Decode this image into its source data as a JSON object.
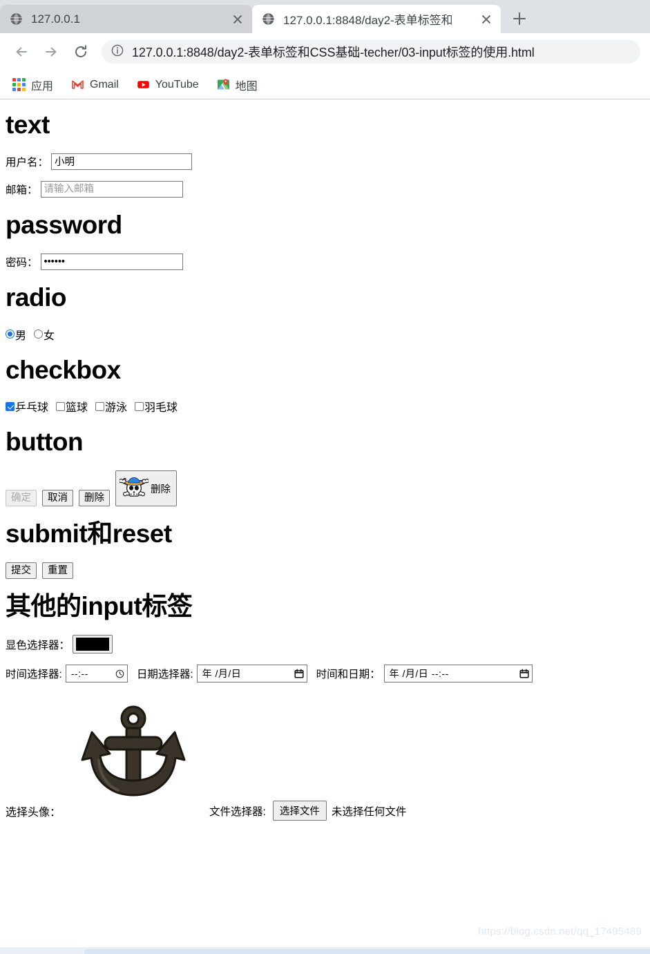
{
  "browser": {
    "tabs": [
      {
        "title": "127.0.0.1",
        "favicon": "globe-icon",
        "active": false
      },
      {
        "title": "127.0.0.1:8848/day2-表单标签和",
        "favicon": "globe-icon",
        "active": true
      }
    ],
    "new_tab_label": "+",
    "nav": {
      "back_icon": "back-arrow-icon",
      "forward_icon": "forward-arrow-icon",
      "reload_icon": "reload-icon"
    },
    "omnibox": {
      "info_icon": "info-circle-icon",
      "url": "127.0.0.1:8848/day2-表单标签和CSS基础-techer/03-input标签的使用.html"
    },
    "bookmarks": [
      {
        "label": "应用",
        "icon": "apps-grid-icon"
      },
      {
        "label": "Gmail",
        "icon": "gmail-icon"
      },
      {
        "label": "YouTube",
        "icon": "youtube-icon"
      },
      {
        "label": "地图",
        "icon": "maps-pin-icon"
      }
    ]
  },
  "page": {
    "sections": {
      "text": {
        "heading": "text",
        "username_label": "用户名：",
        "username_value": "小明",
        "email_label": "邮箱：",
        "email_placeholder": "请输入邮箱",
        "email_value": ""
      },
      "password": {
        "heading": "password",
        "label": "密码：",
        "value": "••••••"
      },
      "radio": {
        "heading": "radio",
        "options": [
          {
            "label": "男",
            "checked": true
          },
          {
            "label": "女",
            "checked": false
          }
        ]
      },
      "checkbox": {
        "heading": "checkbox",
        "options": [
          {
            "label": "乒乓球",
            "checked": true
          },
          {
            "label": "篮球",
            "checked": false
          },
          {
            "label": "游泳",
            "checked": false
          },
          {
            "label": "羽毛球",
            "checked": false
          }
        ]
      },
      "button": {
        "heading": "button",
        "buttons": [
          {
            "label": "确定",
            "disabled": true
          },
          {
            "label": "取消",
            "disabled": false
          },
          {
            "label": "删除",
            "disabled": false
          }
        ],
        "image_button": {
          "label": "删除",
          "icon": "pirate-skull-icon"
        }
      },
      "submit_reset": {
        "heading": "submit和reset",
        "submit_label": "提交",
        "reset_label": "重置"
      },
      "other": {
        "heading": "其他的input标签",
        "color_label": "显色选择器：",
        "color_value": "#000000",
        "time_label": "时间选择器:",
        "time_value": "--:--",
        "time_icon": "clock-icon",
        "date_label": "日期选择器:",
        "date_value": "年 /月/日",
        "date_icon": "calendar-icon",
        "datetime_label": "时间和日期：",
        "datetime_value": "年 /月/日 --:--",
        "datetime_icon": "calendar-icon",
        "avatar_label": "选择头像：",
        "avatar_image": "anchor-icon",
        "file_label": "文件选择器:",
        "file_button": "选择文件",
        "file_status": "未选择任何文件"
      }
    },
    "watermark": "https://blog.csdn.net/qq_17495489"
  },
  "colors": {
    "accent": "#1a73e8",
    "tab_active_bg": "#ffffff",
    "tab_inactive_bg": "#cfd3d8",
    "chrome_bg": "#dee1e6",
    "omnibox_bg": "#f1f3f4",
    "color_swatch": "#000000",
    "anchor_fill": "#3a332a"
  }
}
